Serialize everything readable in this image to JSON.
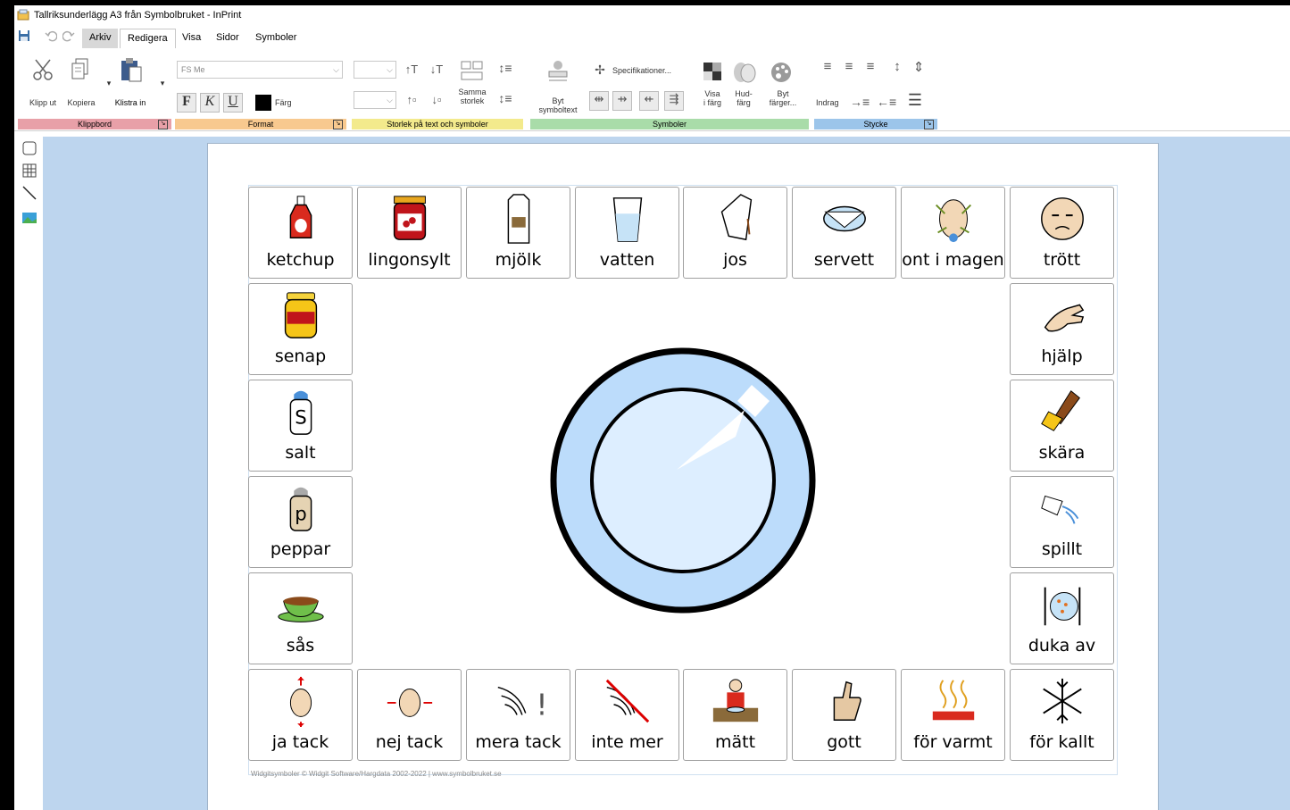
{
  "window": {
    "title": "Tallriksunderlägg A3 från Symbolbruket - InPrint"
  },
  "menu": {
    "tabs": [
      "Arkiv",
      "Redigera",
      "Visa",
      "Sidor",
      "Symboler"
    ],
    "selected": "Redigera"
  },
  "ribbon": {
    "clipboard": {
      "cut": "Klipp ut",
      "copy": "Kopiera",
      "paste": "Klistra in",
      "footer": "Klippbord"
    },
    "format": {
      "font_value": "FS Me",
      "bold": "F",
      "italic": "K",
      "underline": "U",
      "color": "Färg",
      "footer": "Format"
    },
    "size": {
      "same_size_1": "Samma",
      "same_size_2": "storlek",
      "footer": "Storlek på text och symboler"
    },
    "symbols": {
      "spec": "Specifikationer...",
      "swap_1": "Byt",
      "swap_2": "symboltext",
      "show_1": "Visa",
      "show_2": "i färg",
      "skin_1": "Hud-",
      "skin_2": "färg",
      "colors_1": "Byt",
      "colors_2": "färger...",
      "footer": "Symboler"
    },
    "paragraph": {
      "indent": "Indrag",
      "footer": "Stycke"
    }
  },
  "cells": {
    "top": [
      "ketchup",
      "lingonsylt",
      "mjölk",
      "vatten",
      "jos",
      "servett",
      "ont i magen",
      "trött"
    ],
    "left": [
      "senap",
      "salt",
      "peppar",
      "sås"
    ],
    "right": [
      "hjälp",
      "skära",
      "spillt",
      "duka av"
    ],
    "bottom": [
      "ja tack",
      "nej tack",
      "mera tack",
      "inte mer",
      "mätt",
      "gott",
      "för varmt",
      "för kallt"
    ]
  },
  "credit": "Widgitsymboler © Widgit Software/Hargdata 2002-2022 | www.symbolbruket.se",
  "colors": {
    "canvas": "#bdd5ee",
    "plate_rim": "#bcdcfb",
    "clipboard_band": "#e8a0a8",
    "format_band": "#f8c98f",
    "size_band": "#f3ea8c",
    "symbols_band": "#a9dca9",
    "paragraph_band": "#9cc5ea"
  }
}
